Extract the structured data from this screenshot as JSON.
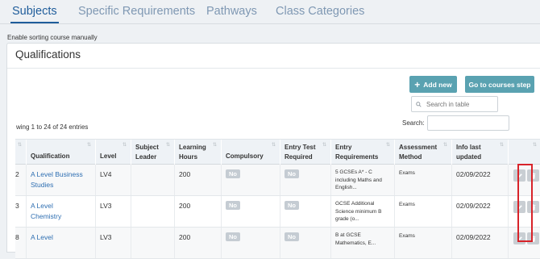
{
  "tabs": [
    {
      "label": "Subjects",
      "active": true
    },
    {
      "label": "Specific Requirements",
      "active": false
    },
    {
      "label": "Pathways",
      "active": false
    },
    {
      "label": "Class Categories",
      "active": false
    }
  ],
  "sort_link": "Enable sorting course manually",
  "panel": {
    "title": "Qualifications",
    "add_new_label": "Add new",
    "go_courses_label": "Go to courses step",
    "search_placeholder": "Search in table",
    "entries_info": "wing 1 to 24 of 24 entries",
    "search_label": "Search:"
  },
  "table": {
    "columns": [
      "",
      "Qualification",
      "Level",
      "Subject Leader",
      "Learning Hours",
      "Compulsory",
      "Entry Test Required",
      "Entry Requirements",
      "Assessment Method",
      "Info last updated",
      ""
    ],
    "rows": [
      {
        "num": "2",
        "qualification": "A Level Business Studies",
        "level": "LV4",
        "leader": "",
        "hours": "200",
        "compulsory": "No",
        "entry_test": "No",
        "requirements": "5 GCSEs A* - C including Maths and English...",
        "assessment": "Exams",
        "updated": "02/09/2022"
      },
      {
        "num": "3",
        "qualification": "A Level Chemistry",
        "level": "LV3",
        "leader": "",
        "hours": "200",
        "compulsory": "No",
        "entry_test": "No",
        "requirements": "GCSE Additional Science minimum B grade (o...",
        "assessment": "Exams",
        "updated": "02/09/2022"
      },
      {
        "num": "8",
        "qualification": "A Level",
        "level": "LV3",
        "leader": "",
        "hours": "200",
        "compulsory": "No",
        "entry_test": "No",
        "requirements": "B at GCSE Mathematics, E...",
        "assessment": "Exams",
        "updated": "02/09/2022"
      }
    ]
  },
  "colors": {
    "accent": "#1f5d9b",
    "button": "#5aa2b1",
    "link": "#2f6fb2",
    "highlight": "#d8232a"
  }
}
